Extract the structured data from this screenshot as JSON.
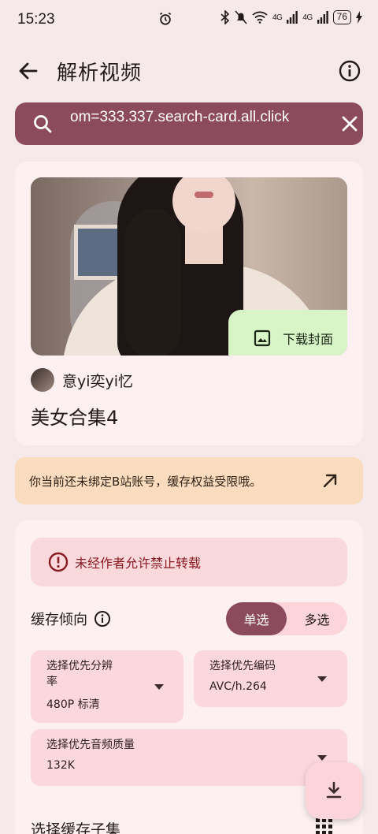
{
  "status_bar": {
    "time": "15:23",
    "signal_1": "4G",
    "signal_2": "4G",
    "battery": "76"
  },
  "header": {
    "title": "解析视频",
    "back_icon": "arrow-left-icon",
    "info_icon": "info-icon"
  },
  "search": {
    "value": "om=333.337.search-card.all.click",
    "search_icon": "search-icon",
    "clear_icon": "close-icon"
  },
  "video": {
    "download_cover_label": "下载封面",
    "author": "意yi奕yi忆",
    "title": "美女合集4"
  },
  "notice": {
    "text": "你当前还未绑定B站账号，缓存权益受限哦。",
    "icon": "arrow-up-right-icon"
  },
  "options": {
    "warning": "未经作者允许禁止转载",
    "preference_label": "缓存倾向",
    "mode_single": "单选",
    "mode_multi": "多选",
    "resolution_label_line1": "选择优先分辨",
    "resolution_label_line2": "率",
    "resolution_value": "480P 标清",
    "codec_label": "选择优先编码",
    "codec_value": "AVC/h.264",
    "audio_label": "选择优先音频质量",
    "audio_value": "132K",
    "sub_episodes_label": "选择缓存子集"
  },
  "colors": {
    "primary": "#8c4a5d",
    "background": "#f6e9eb",
    "notice_bg": "#fbdcbf",
    "warning_text": "#8a1a22",
    "cover_button_bg": "#d8f5c8"
  }
}
